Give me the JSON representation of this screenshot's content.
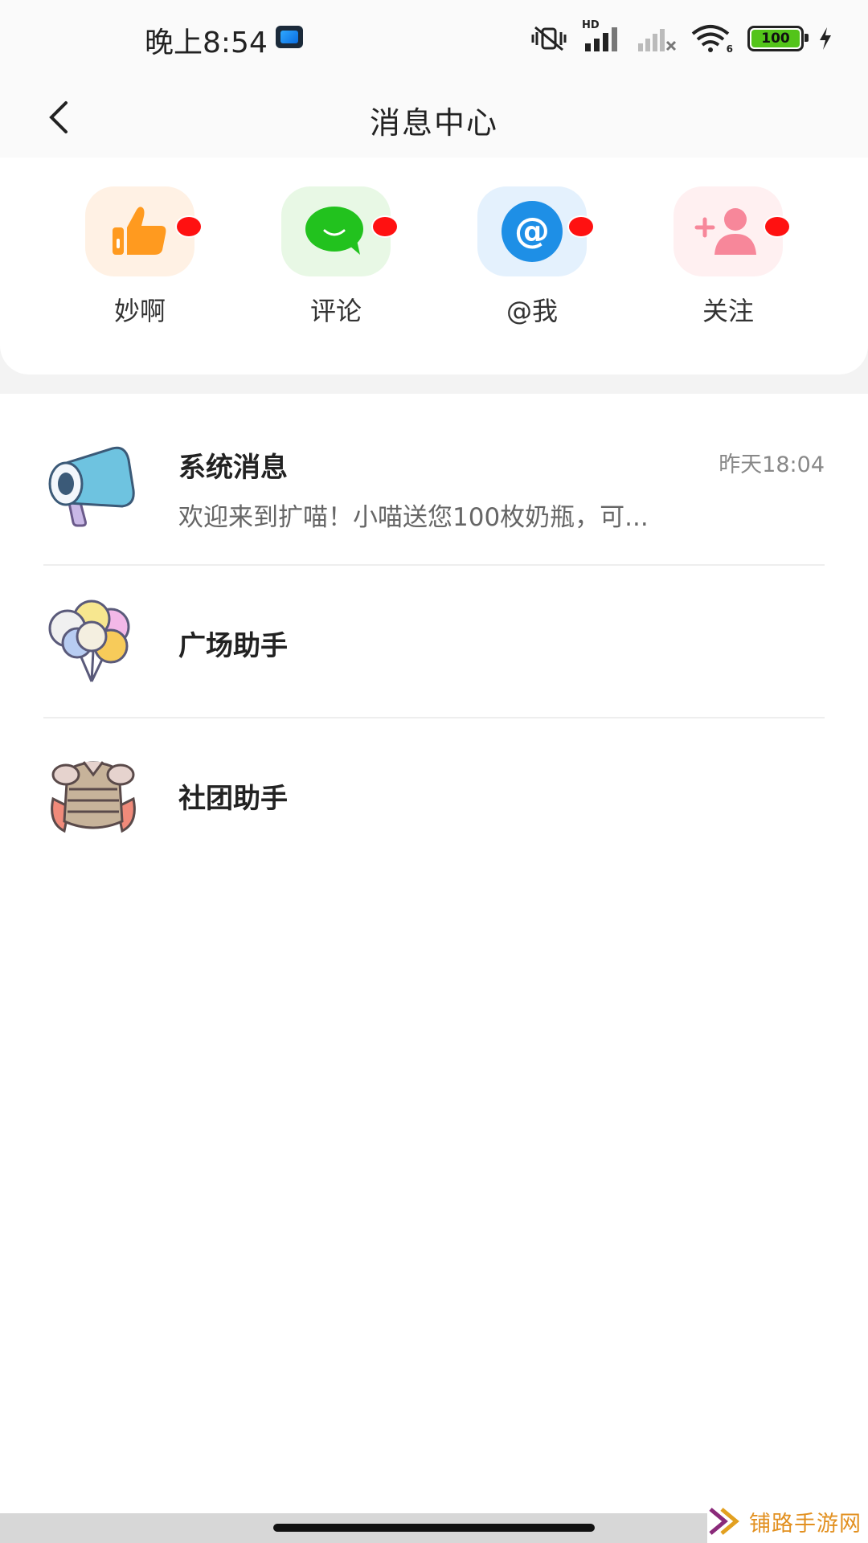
{
  "status_bar": {
    "time": "晚上8:54",
    "signal_label": "HD",
    "battery": "100",
    "wifi_badge": "6"
  },
  "header": {
    "title": "消息中心",
    "back_icon": "chevron-left-icon"
  },
  "quick_actions": [
    {
      "label": "妙啊",
      "icon": "thumbs-up-icon",
      "tile_color": "#fff1e4",
      "icon_color": "#ff9a1f",
      "has_badge": true
    },
    {
      "label": "评论",
      "icon": "chat-bubble-icon",
      "tile_color": "#e8f8e5",
      "icon_color": "#22c21e",
      "has_badge": true
    },
    {
      "label": "@我",
      "icon": "at-icon",
      "tile_color": "#e4f1fd",
      "icon_color": "#1e8fe6",
      "has_badge": true
    },
    {
      "label": "关注",
      "icon": "add-user-icon",
      "tile_color": "#fff0f1",
      "icon_color": "#f7879a",
      "has_badge": true
    }
  ],
  "messages": [
    {
      "title": "系统消息",
      "time": "昨天18:04",
      "preview": "欢迎来到扩喵！小喵送您100枚奶瓶，可...",
      "icon": "megaphone-icon"
    },
    {
      "title": "广场助手",
      "icon": "balloons-icon"
    },
    {
      "title": "社团助手",
      "icon": "armor-icon"
    }
  ],
  "watermark": {
    "text": "铺路手游网"
  },
  "colors": {
    "badge_red": "#ff1111",
    "page_bg": "#ffffff",
    "panel_gap": "#f3f3f3"
  }
}
